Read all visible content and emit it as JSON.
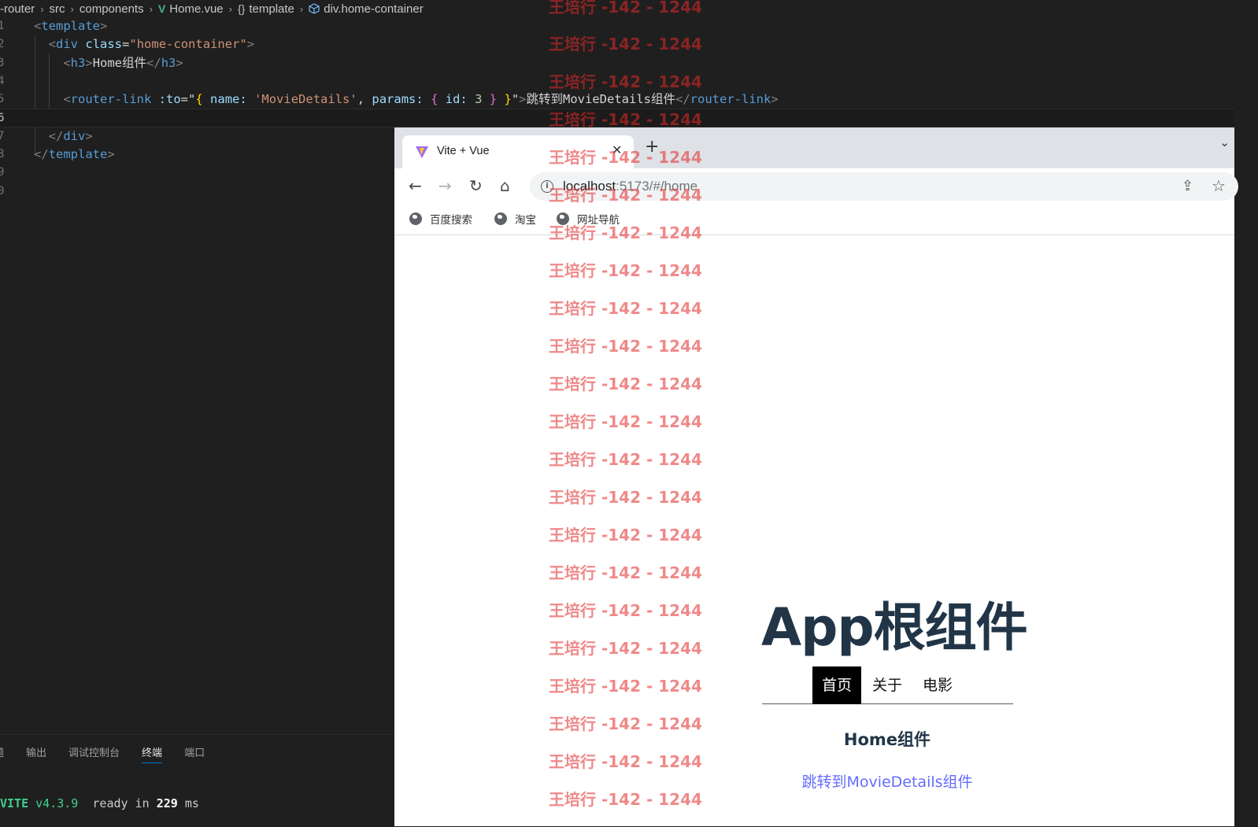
{
  "editor": {
    "breadcrumb": [
      "-router",
      "src",
      "components",
      "Home.vue",
      "template",
      "div.home-container"
    ],
    "line_numbers": [
      "1",
      "2",
      "3",
      "4",
      "5",
      "6",
      "7",
      "8",
      "9",
      "0"
    ],
    "code": {
      "l1_tag": "template",
      "l2_tag": "div",
      "l2_attr": "class",
      "l2_value": "\"home-container\"",
      "l3_tag": "h3",
      "l3_text": "Home组件",
      "l5_tag": "router-link",
      "l5_attr": ":to",
      "l5_name_key": "name:",
      "l5_name_val": "'MovieDetails'",
      "l5_params_key": "params:",
      "l5_id_key": "id:",
      "l5_id_val": "3",
      "l5_text": "跳转到MovieDetails组件",
      "l7_tag": "div",
      "l8_tag": "template"
    }
  },
  "panel": {
    "tabs": [
      "题",
      "输出",
      "调试控制台",
      "终端",
      "端口"
    ],
    "active_tab": "终端",
    "terminal": {
      "name": "VITE",
      "version": "v4.3.9",
      "ready": "ready in",
      "time": "229",
      "unit": "ms"
    }
  },
  "browser": {
    "tab_title": "Vite + Vue",
    "url_host": "localhost",
    "url_rest": ":5173/#/home",
    "bookmarks": [
      "百度搜索",
      "淘宝",
      "网址导航"
    ]
  },
  "app": {
    "title": "App根组件",
    "nav": [
      "首页",
      "关于",
      "电影"
    ],
    "active_nav": "首页",
    "heading": "Home组件",
    "link_text": "跳转到MovieDetails组件"
  },
  "watermark": "王培行 -142 - 1244"
}
